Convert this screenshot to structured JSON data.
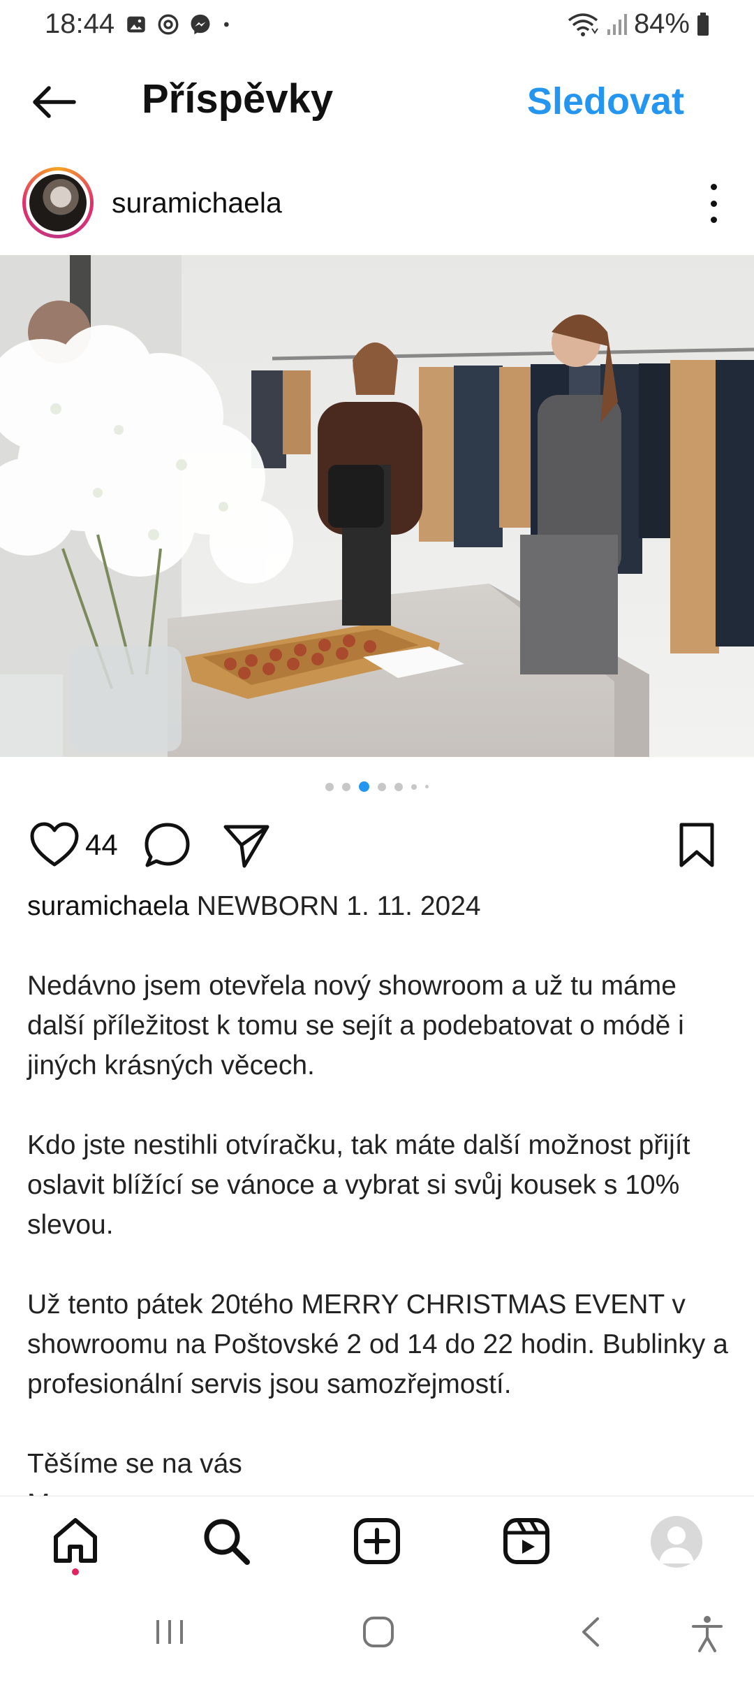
{
  "status_bar": {
    "time": "18:44",
    "battery": "84%",
    "icons": [
      "image-icon",
      "sync-icon",
      "messenger-icon",
      "dot-icon",
      "wifi-icon",
      "signal-icon",
      "battery-icon"
    ]
  },
  "header": {
    "title": "Příspěvky",
    "follow_label": "Sledovat",
    "back_icon": "back-arrow-icon"
  },
  "post": {
    "username": "suramichaela",
    "likes": "44",
    "carousel": {
      "total": 7,
      "active_index": 2
    },
    "caption": {
      "username": "suramichaela",
      "first_line": "NEWBORN 1. 11. 2024",
      "paragraph1": "Nedávno jsem otevřela nový showroom a už tu máme další příležitost k tomu se sejít a podebatovat o módě i jiných krásných věcech.",
      "paragraph2": "Kdo jste nestihli otvíračku, tak máte další možnost přijít oslavit blížící se vánoce a vybrat si svůj kousek s 10% slevou.",
      "paragraph3": "Už tento pátek 20tého MERRY CHRISTMAS EVENT v showroomu na Poštovské 2 od 14 do 22 hodin. Bublinky a profesionální servis jsou samozřejmostí.",
      "paragraph4": "Těšíme se na vás",
      "sign": "M+"
    }
  },
  "bottom_nav": {
    "items": [
      "home-icon",
      "search-icon",
      "create-icon",
      "reels-icon",
      "profile-avatar"
    ]
  },
  "colors": {
    "accent": "#2596f0",
    "notification": "#e0245e"
  }
}
